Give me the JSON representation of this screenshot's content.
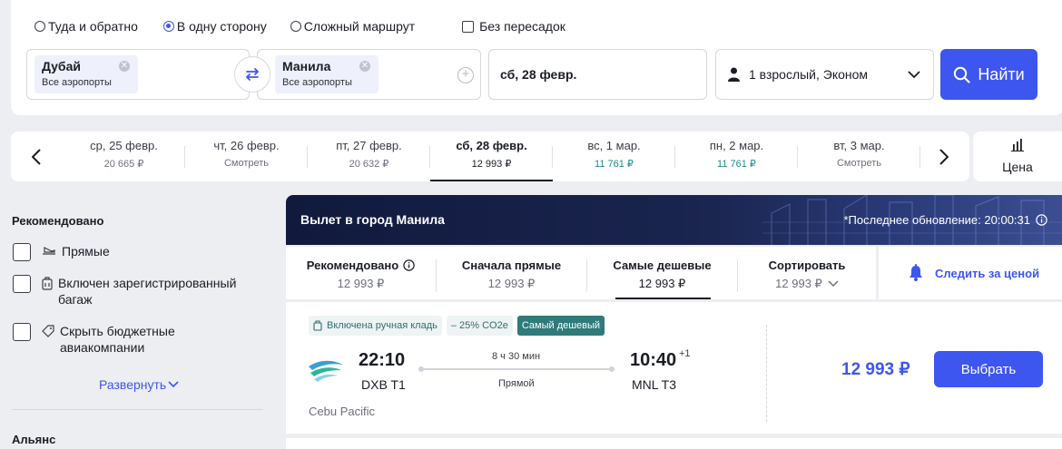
{
  "trip_types": [
    {
      "label": "Туда и обратно",
      "selected": false
    },
    {
      "label": "В одну сторону",
      "selected": true
    },
    {
      "label": "Сложный маршрут",
      "selected": false
    }
  ],
  "nonstop_label": "Без пересадок",
  "origin": {
    "city": "Дубай",
    "sub": "Все аэропорты"
  },
  "destination": {
    "city": "Манила",
    "sub": "Все аэропорты"
  },
  "date_field": "сб, 28 февр.",
  "passengers": "1 взрослый, Эконом",
  "search_button": "Найти",
  "dates": [
    {
      "day": "ср, 25 февр.",
      "price": "20 665 ₽"
    },
    {
      "day": "чт, 26 февр.",
      "price": "Смотреть"
    },
    {
      "day": "пт, 27 февр.",
      "price": "20 632 ₽"
    },
    {
      "day": "сб, 28 февр.",
      "price": "12 993 ₽",
      "active": true
    },
    {
      "day": "вс, 1 мар.",
      "price": "11 761 ₽",
      "cheap": true
    },
    {
      "day": "пн, 2 мар.",
      "price": "11 761 ₽",
      "cheap": true
    },
    {
      "day": "вт, 3 мар.",
      "price": "Смотреть"
    }
  ],
  "price_sort_label": "Цена",
  "sidebar": {
    "title": "Рекомендовано",
    "filters": [
      {
        "label": "Прямые",
        "icon": "plane-icon"
      },
      {
        "label": "Включен зарегистрированный багаж",
        "icon": "luggage-icon"
      },
      {
        "label": "Скрыть бюджетные авиакомпании",
        "icon": "tag-icon"
      }
    ],
    "expand_label": "Развернуть",
    "alliance_title": "Альянс"
  },
  "banner": {
    "title": "Вылет в город Манила",
    "update": "*Последнее обновление: 20:00:31"
  },
  "sort_tabs": [
    {
      "title": "Рекомендовано",
      "value": "12 993 ₽",
      "info": true
    },
    {
      "title": "Сначала прямые",
      "value": "12 993 ₽"
    },
    {
      "title": "Самые дешевые",
      "value": "12 993 ₽",
      "active": true
    },
    {
      "title": "Сортировать",
      "value": "12 993 ₽",
      "chevron": true
    }
  ],
  "track_price_label": "Следить за ценой",
  "ticket": {
    "badges": [
      "Включена ручная кладь",
      "– 25% CO2e",
      "Самый дешевый"
    ],
    "dep_time": "22:10",
    "dep_code": "DXB T1",
    "duration": "8 ч 30 мин",
    "stops": "Прямой",
    "arr_time": "10:40",
    "arr_plus": "+1",
    "arr_code": "MNL T3",
    "airline": "Cebu Pacific",
    "price": "12 993 ₽",
    "select_label": "Выбрать"
  },
  "colors": {
    "accent": "#3d56f0",
    "cheap": "#1e8a8a",
    "banner": "#111a3c"
  }
}
